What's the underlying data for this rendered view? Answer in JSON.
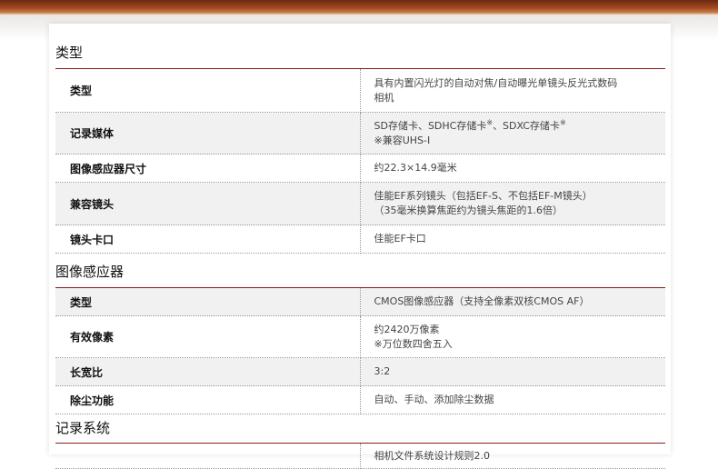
{
  "sections": [
    {
      "title": "类型",
      "rows": [
        {
          "key": "类型",
          "lines": [
            "具有内置闪光灯的自动对焦/自动曝光单镜头反光式数码",
            "相机"
          ]
        },
        {
          "key": "记录媒体",
          "lines": [
            "SD存储卡、SDHC存储卡※、SDXC存储卡※",
            "※兼容UHS-I"
          ]
        },
        {
          "key": "图像感应器尺寸",
          "lines": [
            "约22.3×14.9毫米"
          ]
        },
        {
          "key": "兼容镜头",
          "lines": [
            "佳能EF系列镜头（包括EF-S、不包括EF-M镜头）",
            "（35毫米换算焦距约为镜头焦距的1.6倍）"
          ]
        },
        {
          "key": "镜头卡口",
          "lines": [
            "佳能EF卡口"
          ]
        }
      ]
    },
    {
      "title": "图像感应器",
      "rows": [
        {
          "key": "类型",
          "lines": [
            "CMOS图像感应器（支持全像素双核CMOS AF）"
          ]
        },
        {
          "key": "有效像素",
          "lines": [
            "约2420万像素",
            "※万位数四舍五入"
          ]
        },
        {
          "key": "长宽比",
          "lines": [
            "3:2"
          ]
        },
        {
          "key": "除尘功能",
          "lines": [
            "自动、手动、添加除尘数据"
          ]
        }
      ]
    },
    {
      "title": "记录系统",
      "rows": [
        {
          "key": "",
          "lines": [
            "相机文件系统设计规则2.0"
          ]
        }
      ]
    }
  ]
}
